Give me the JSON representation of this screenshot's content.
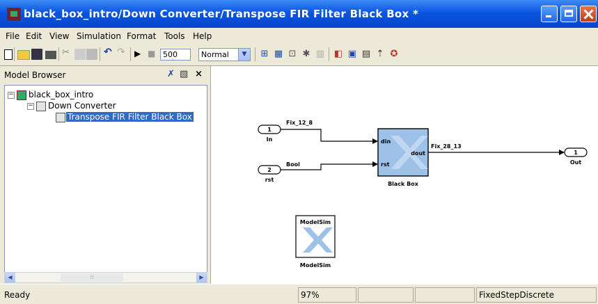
{
  "window": {
    "title": "black_box_intro/Down Converter/Transpose FIR Filter Black Box *"
  },
  "menu": [
    "File",
    "Edit",
    "View",
    "Simulation",
    "Format",
    "Tools",
    "Help"
  ],
  "toolbar": {
    "stop_time": "500",
    "sim_mode": "Normal"
  },
  "browser": {
    "title": "Model Browser",
    "tree": {
      "root": "black_box_intro",
      "child": "Down Converter",
      "grandchild": "Transpose FIR Filter Black Box"
    }
  },
  "diagram": {
    "in_port": {
      "number": "1",
      "label": "In"
    },
    "rst_port": {
      "number": "2",
      "label": "rst"
    },
    "out_port": {
      "number": "1",
      "label": "Out"
    },
    "signal_in": "Fix_12_8",
    "signal_rst": "Bool",
    "signal_out": "Fix_28_13",
    "blackbox": {
      "label": "Black Box",
      "port_din": "din",
      "port_rst": "rst",
      "port_dout": "dout"
    },
    "modelsim": {
      "label": "ModelSim",
      "inner": "ModelSim"
    }
  },
  "status": {
    "state": "Ready",
    "zoom": "97%",
    "solver": "FixedStepDiscrete"
  }
}
